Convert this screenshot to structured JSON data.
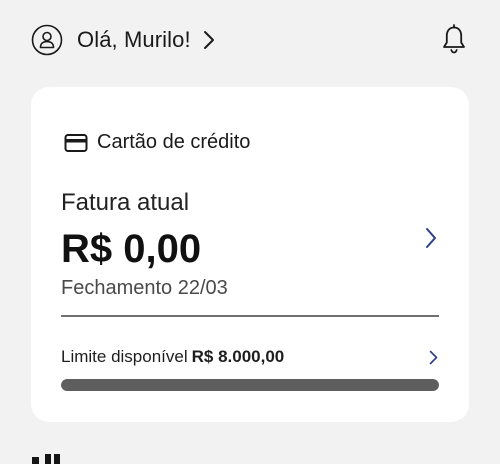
{
  "header": {
    "greeting": "Olá, Murilo!"
  },
  "credit_card": {
    "title": "Cartão de crédito",
    "invoice": {
      "label": "Fatura atual",
      "amount": "R$ 0,00",
      "closing": "Fechamento 22/03"
    },
    "limit": {
      "label": "Limite disponível",
      "value": "R$ 8.000,00",
      "available_fraction": 1.0
    }
  },
  "icons": {
    "profile": "user-circle-icon",
    "notifications": "bell-icon",
    "card": "credit-card-icon",
    "chevron": "chevron-right-icon"
  },
  "colors": {
    "background": "#f2f2f2",
    "card": "#ffffff",
    "bar_fill": "#5e5e5e",
    "invoice_chevron": "#2c3e8c"
  }
}
